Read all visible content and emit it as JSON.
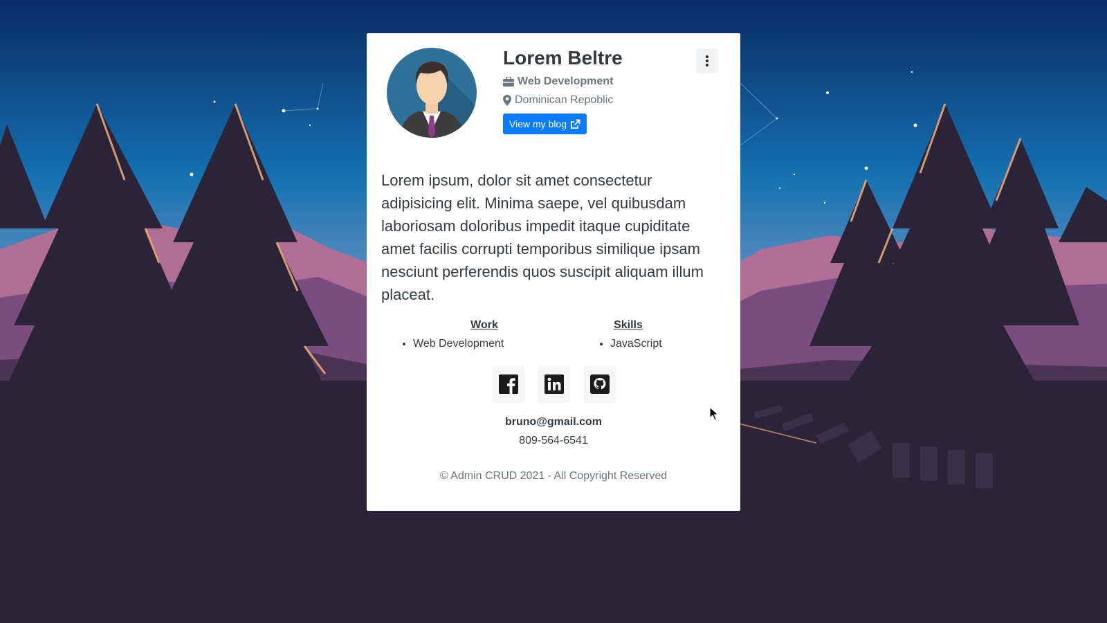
{
  "profile": {
    "name": "Lorem Beltre",
    "job": "Web Development",
    "location": "Dominican Repoblic",
    "blog_button": "View my blog",
    "bio": "Lorem ipsum, dolor sit amet consectetur adipisicing elit. Minima saepe, vel quibusdam laboriosam doloribus impedit itaque cupiditate amet facilis corrupti temporibus similique ipsam nesciunt perferendis quos suscipit aliquam illum placeat."
  },
  "sections": {
    "work": {
      "title": "Work",
      "items": [
        "Web Development"
      ]
    },
    "skills": {
      "title": "Skills",
      "items": [
        "JavaScript"
      ]
    }
  },
  "socials": [
    {
      "icon": "facebook-icon"
    },
    {
      "icon": "linkedin-icon"
    },
    {
      "icon": "github-icon"
    }
  ],
  "contact": {
    "email": "bruno@gmail.com",
    "phone": "809-564-6541"
  },
  "footer": {
    "copyright": "© Admin CRUD 2021 - All Copyright Reserved"
  },
  "colors": {
    "accent": "#0d7bf7",
    "sky_top": "#0b2a66",
    "ground": "#2b2438"
  }
}
